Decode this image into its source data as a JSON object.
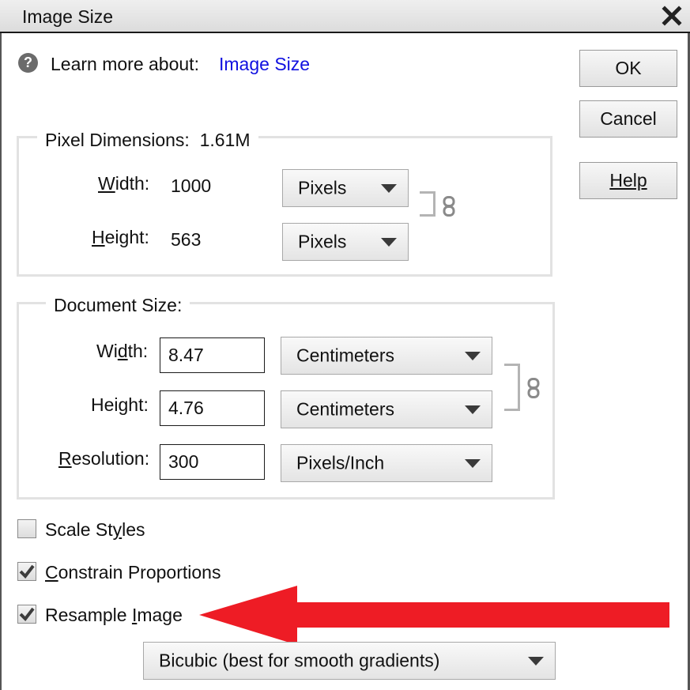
{
  "window": {
    "title": "Image Size",
    "close_icon": "close-icon"
  },
  "help_line": {
    "label": "Learn more about:",
    "link": "Image Size",
    "icon": "question-circle-icon"
  },
  "buttons": {
    "ok": "OK",
    "cancel": "Cancel",
    "help": "Help"
  },
  "pixel_dimensions": {
    "legend": "Pixel Dimensions:",
    "size": "1.61M",
    "width_label": "Width:",
    "width_value": "1000",
    "width_unit": "Pixels",
    "height_label": "Height:",
    "height_value": "563",
    "height_unit": "Pixels"
  },
  "document_size": {
    "legend": "Document Size:",
    "width_label": "Width:",
    "width_value": "8.47",
    "width_unit": "Centimeters",
    "height_label": "Height:",
    "height_value": "4.76",
    "height_unit": "Centimeters",
    "resolution_label": "Resolution:",
    "resolution_value": "300",
    "resolution_unit": "Pixels/Inch"
  },
  "options": {
    "scale_styles": {
      "label": "Scale Styles",
      "checked": false
    },
    "constrain_proportions": {
      "label": "Constrain Proportions",
      "checked": true
    },
    "resample_image": {
      "label": "Resample Image",
      "checked": true
    }
  },
  "resample_method": "Bicubic (best for smooth gradients)",
  "colors": {
    "link": "#1010e0",
    "annotation_arrow": "#ee1c25",
    "dialog_bg": "#ffffff"
  }
}
